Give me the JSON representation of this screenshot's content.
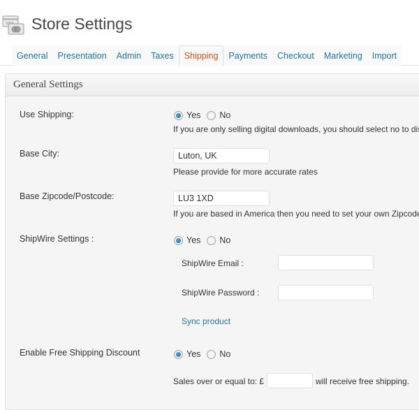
{
  "header": {
    "title": "Store Settings",
    "icon": "credit-cards-icon"
  },
  "tabs": [
    {
      "label": "General",
      "active": false
    },
    {
      "label": "Presentation",
      "active": false
    },
    {
      "label": "Admin",
      "active": false
    },
    {
      "label": "Taxes",
      "active": false
    },
    {
      "label": "Shipping",
      "active": true
    },
    {
      "label": "Payments",
      "active": false
    },
    {
      "label": "Checkout",
      "active": false
    },
    {
      "label": "Marketing",
      "active": false
    },
    {
      "label": "Import",
      "active": false
    }
  ],
  "panel": {
    "title": "General Settings",
    "use_shipping": {
      "label": "Use Shipping:",
      "yes": "Yes",
      "no": "No",
      "selected": "Yes",
      "help": "If you are only selling digital downloads, you should select no to disable the shipping on your site."
    },
    "base_city": {
      "label": "Base City:",
      "value": "Luton, UK",
      "help": "Please provide for more accurate rates"
    },
    "base_zip": {
      "label": "Base Zipcode/Postcode:",
      "value": "LU3 1XD",
      "help": "If you are based in America then you need to set your own Zipcode for UPS and USPS to work."
    },
    "shipwire": {
      "label": "ShipWire Settings :",
      "yes": "Yes",
      "no": "No",
      "selected": "Yes",
      "email_label": "ShipWire Email :",
      "email_value": "",
      "password_label": "ShipWire Password :",
      "password_value": "",
      "sync_link": "Sync product"
    },
    "free_shipping": {
      "label": "Enable Free Shipping Discount",
      "yes": "Yes",
      "no": "No",
      "selected": "Yes",
      "prefix": "Sales over or equal to: £",
      "value": "",
      "suffix": "will receive free shipping."
    }
  },
  "colors": {
    "link": "#21759b",
    "active_tab": "#d54e21",
    "panel_bg": "#f5f5f5"
  }
}
